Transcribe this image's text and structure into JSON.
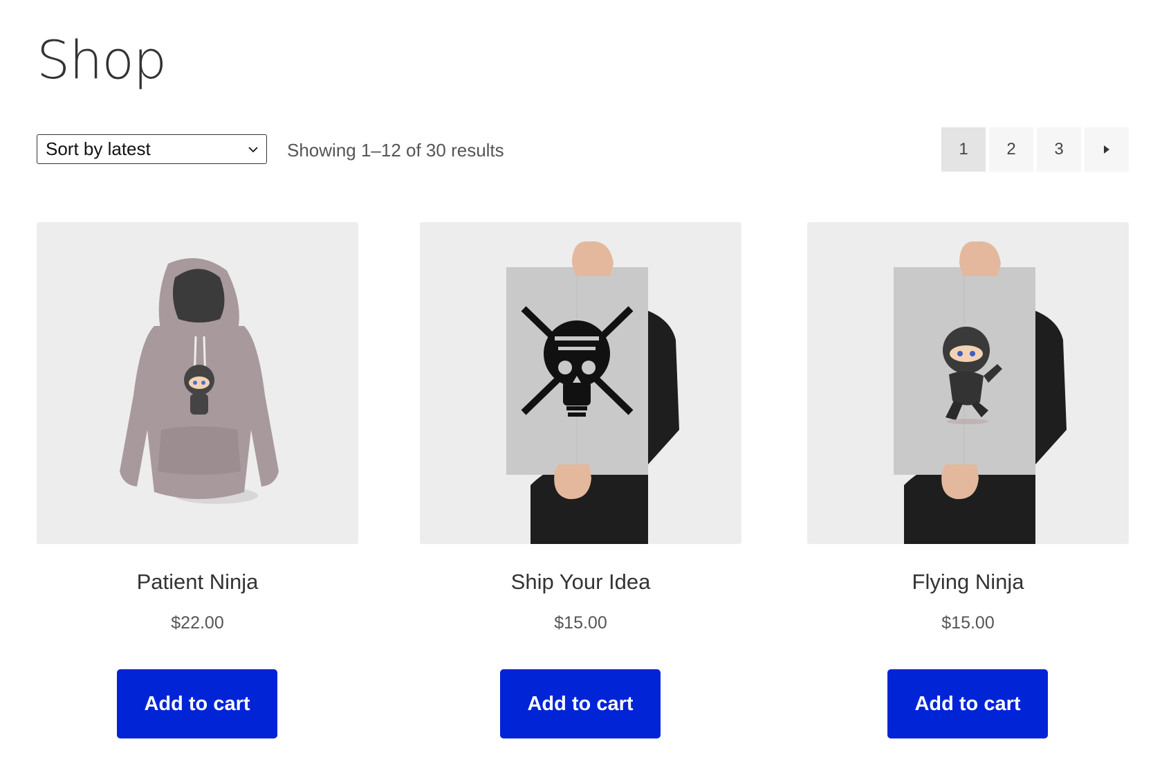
{
  "page": {
    "title": "Shop"
  },
  "toolbar": {
    "sort_label": "Sort by latest",
    "sort_icon": "chevron-down-icon",
    "results_text": "Showing 1–12 of 30 results"
  },
  "pagination": {
    "pages": [
      "1",
      "2",
      "3"
    ],
    "current_page": "1",
    "next_icon": "triangle-right-icon"
  },
  "products": [
    {
      "name": "Patient Ninja",
      "price": "$22.00",
      "button_label": "Add to cart",
      "image": "grey-hoodie-with-ninja-graphic"
    },
    {
      "name": "Ship Your Idea",
      "price": "$15.00",
      "button_label": "Add to cart",
      "image": "poster-skull-lightbulb"
    },
    {
      "name": "Flying Ninja",
      "price": "$15.00",
      "button_label": "Add to cart",
      "image": "poster-flying-ninja"
    }
  ],
  "colors": {
    "button_bg": "#0024d6",
    "button_text": "#ffffff",
    "image_bg": "#ededed",
    "page_current_bg": "#e4e4e4",
    "page_bg": "#f6f6f6"
  }
}
